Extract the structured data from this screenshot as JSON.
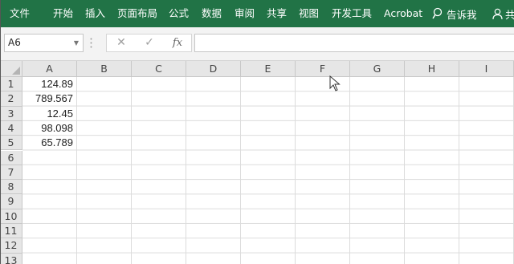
{
  "ribbon": {
    "tabs": [
      "文件",
      "开始",
      "插入",
      "页面布局",
      "公式",
      "数据",
      "审阅",
      "共享",
      "视图",
      "开发工具",
      "Acrobat"
    ],
    "tell_me": "告诉我",
    "share_partial": "共",
    "background_color": "#217346"
  },
  "formula_bar": {
    "name_box": "A6",
    "formula_value": "",
    "buttons": [
      "cancel-icon",
      "enter-icon",
      "fx-icon"
    ]
  },
  "sheet": {
    "columns": [
      "A",
      "B",
      "C",
      "D",
      "E",
      "F",
      "G",
      "H",
      "I"
    ],
    "rows": [
      "1",
      "2",
      "3",
      "4",
      "5",
      "6",
      "7",
      "8",
      "9",
      "10",
      "11",
      "12",
      "13"
    ],
    "column_a_values": [
      "124.89",
      "789.567",
      "12.45",
      "98.098",
      "65.789"
    ]
  }
}
